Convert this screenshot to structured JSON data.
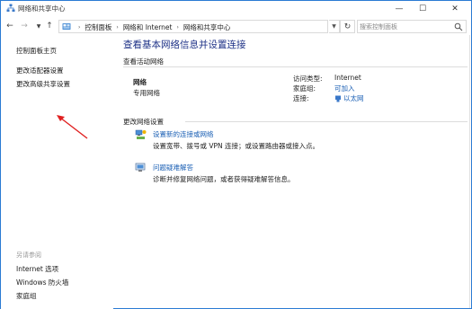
{
  "window": {
    "title": "网络和共享中心",
    "controls": {
      "minimize": "—",
      "maximize": "☐",
      "close": "✕"
    }
  },
  "address_bar": {
    "crumbs": [
      "控制面板",
      "网络和 Internet",
      "网络和共享中心"
    ],
    "search_placeholder": "搜索控制面板"
  },
  "left_pane": {
    "links": [
      "控制面板主页",
      "更改适配器设置",
      "更改高级共享设置"
    ],
    "see_also_title": "另请参阅",
    "see_also": [
      "Internet 选项",
      "Windows 防火墙",
      "家庭组"
    ]
  },
  "main": {
    "title": "查看基本网络信息并设置连接",
    "active_networks_heading": "查看活动网络",
    "network": {
      "name": "网络",
      "type": "专用网络",
      "access_type_label": "访问类型:",
      "access_type_value": "Internet",
      "homegroup_label": "家庭组:",
      "homegroup_value": "可加入",
      "connection_label": "连接:",
      "connection_value": "以太网"
    },
    "change_settings_heading": "更改网络设置",
    "tasks": [
      {
        "link": "设置新的连接或网络",
        "description": "设置宽带、拨号或 VPN 连接；或设置路由器或接入点。"
      },
      {
        "link": "问题疑难解答",
        "description": "诊断并修复网络问题，或者获得疑难解答信息。"
      }
    ]
  },
  "colors": {
    "accent": "#1a5fb4",
    "title_blue": "#1e3287",
    "annotation_arrow": "#e02020"
  }
}
